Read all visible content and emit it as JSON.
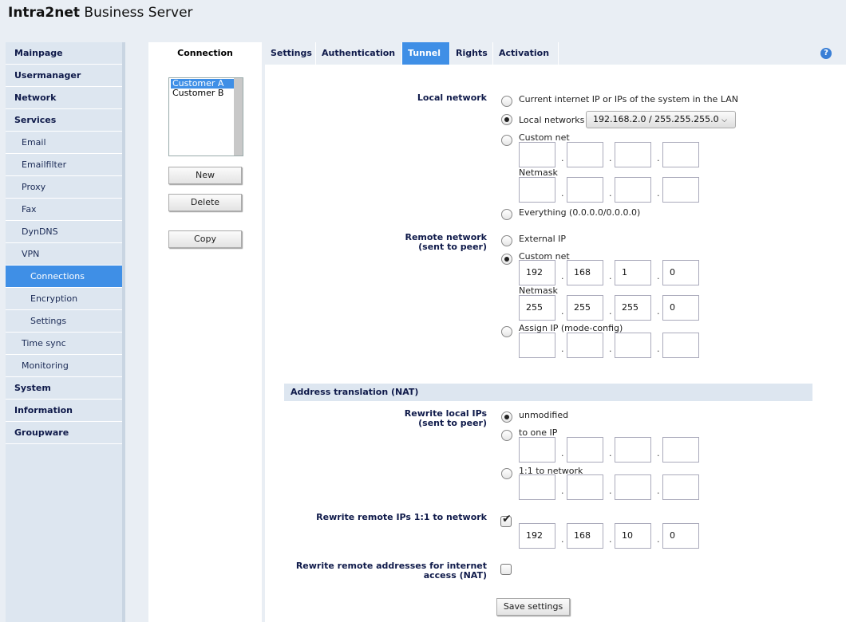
{
  "brand": {
    "bold": "Intra2net",
    "rest": " Business Server"
  },
  "sidebar": {
    "items": [
      {
        "label": "Mainpage"
      },
      {
        "label": "Usermanager"
      },
      {
        "label": "Network"
      },
      {
        "label": "Services"
      },
      {
        "label": "Email"
      },
      {
        "label": "Emailfilter"
      },
      {
        "label": "Proxy"
      },
      {
        "label": "Fax"
      },
      {
        "label": "DynDNS"
      },
      {
        "label": "VPN"
      },
      {
        "label": "Connections"
      },
      {
        "label": "Encryption"
      },
      {
        "label": "Settings"
      },
      {
        "label": "Time sync"
      },
      {
        "label": "Monitoring"
      },
      {
        "label": "System"
      },
      {
        "label": "Information"
      },
      {
        "label": "Groupware"
      }
    ]
  },
  "connections": {
    "title": "Connection",
    "list": [
      "Customer A",
      "Customer B"
    ],
    "new_label": "New",
    "delete_label": "Delete",
    "copy_label": "Copy"
  },
  "tabs": [
    "Settings",
    "Authentication",
    "Tunnel",
    "Rights",
    "Activation"
  ],
  "help_icon": "?",
  "local_network": {
    "label": "Local network",
    "opt_current": "Current internet IP or IPs of the system in the LAN",
    "opt_local": "Local networks",
    "local_select": "192.168.2.0 / 255.255.255.0",
    "opt_custom": "Custom net",
    "netmask": "Netmask",
    "opt_everything": "Everything (0.0.0.0/0.0.0.0)"
  },
  "remote_network": {
    "label1": "Remote network",
    "label2": "(sent to peer)",
    "opt_external": "External IP",
    "opt_custom": "Custom net",
    "net": [
      "192",
      "168",
      "1",
      "0"
    ],
    "netmask_label": "Netmask",
    "mask": [
      "255",
      "255",
      "255",
      "0"
    ],
    "opt_assign": "Assign IP (mode-config)"
  },
  "nat": {
    "section": "Address translation (NAT)",
    "rewrite_local_1": "Rewrite local IPs",
    "rewrite_local_2": "(sent to peer)",
    "opt_unmodified": "unmodified",
    "opt_one_ip": "to one IP",
    "opt_network": "1:1 to network",
    "rewrite_remote": "Rewrite remote IPs 1:1 to network",
    "remote_ip": [
      "192",
      "168",
      "10",
      "0"
    ],
    "rewrite_inet_1": "Rewrite remote addresses for internet",
    "rewrite_inet_2": "access (NAT)"
  },
  "save_label": "Save settings"
}
